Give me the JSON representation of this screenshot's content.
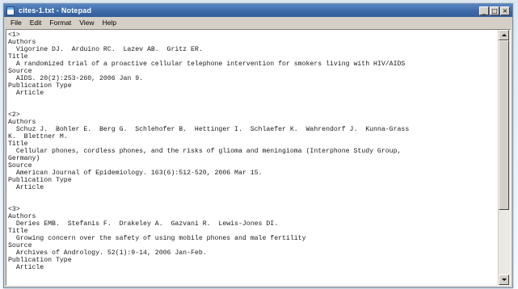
{
  "window": {
    "title": "cites-1.txt - Notepad",
    "controls": {
      "minimize": "_",
      "maximize": "□",
      "close": "×"
    }
  },
  "menu": [
    "File",
    "Edit",
    "Format",
    "View",
    "Help"
  ],
  "lines": [
    "<1>",
    "Authors",
    "  Vigorine DJ.  Arduino RC.  Lazev AB.  Gritz ER.",
    "Title",
    "  A randomized trial of a proactive cellular telephone intervention for smokers living with HIV/AIDS",
    "Source",
    "  AIDS. 20(2):253-260, 2006 Jan 9.",
    "Publication Type",
    "  Article",
    "",
    "",
    "<2>",
    "Authors",
    "  Schuz J.  Bohler E.  Berg G.  Schlehofer B.  Hettinger I.  Schlaefer K.  Wahrendorf J.  Kunna-Grass",
    "K.  Blettner M.",
    "Title",
    "  Cellular phones, cordless phones, and the risks of glioma and meningioma (Interphone Study Group,",
    "Germany)",
    "Source",
    "  American Journal of Epidemiology. 163(6):512-520, 2006 Mar 15.",
    "Publication Type",
    "  Article",
    "",
    "",
    "<3>",
    "Authors",
    "  Deries EMB.  Stefanis F.  Drakeley A.  Gazvani R.  Lewis-Jones DI.",
    "Title",
    "  Growing concern over the safety of using mobile phones and male fertility",
    "Source",
    "  Archives of Andrology. 52(1):9-14, 2006 Jan-Feb.",
    "Publication Type",
    "  Article",
    "",
    ""
  ]
}
